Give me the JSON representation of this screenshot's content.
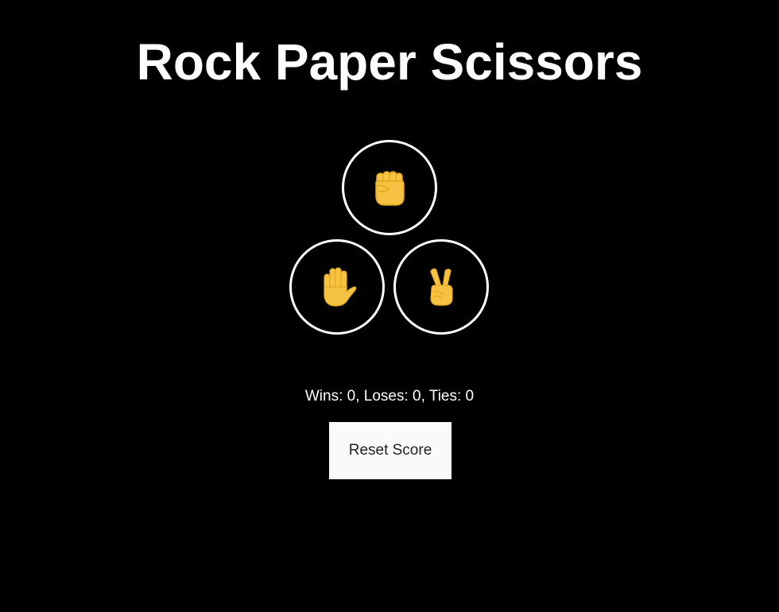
{
  "title": "Rock Paper Scissors",
  "choices": [
    {
      "name": "rock",
      "icon": "raised-fist-icon"
    },
    {
      "name": "paper",
      "icon": "raised-hand-icon"
    },
    {
      "name": "scissors",
      "icon": "victory-hand-icon"
    }
  ],
  "score": {
    "wins": 0,
    "loses": 0,
    "ties": 0,
    "text": "Wins: 0, Loses: 0, Ties: 0"
  },
  "reset_label": "Reset Score",
  "colors": {
    "background": "#000000",
    "foreground": "#ffffff",
    "emoji": "#f6c244",
    "emoji_shadow": "#e3a71a",
    "button_bg": "#fafafa"
  }
}
